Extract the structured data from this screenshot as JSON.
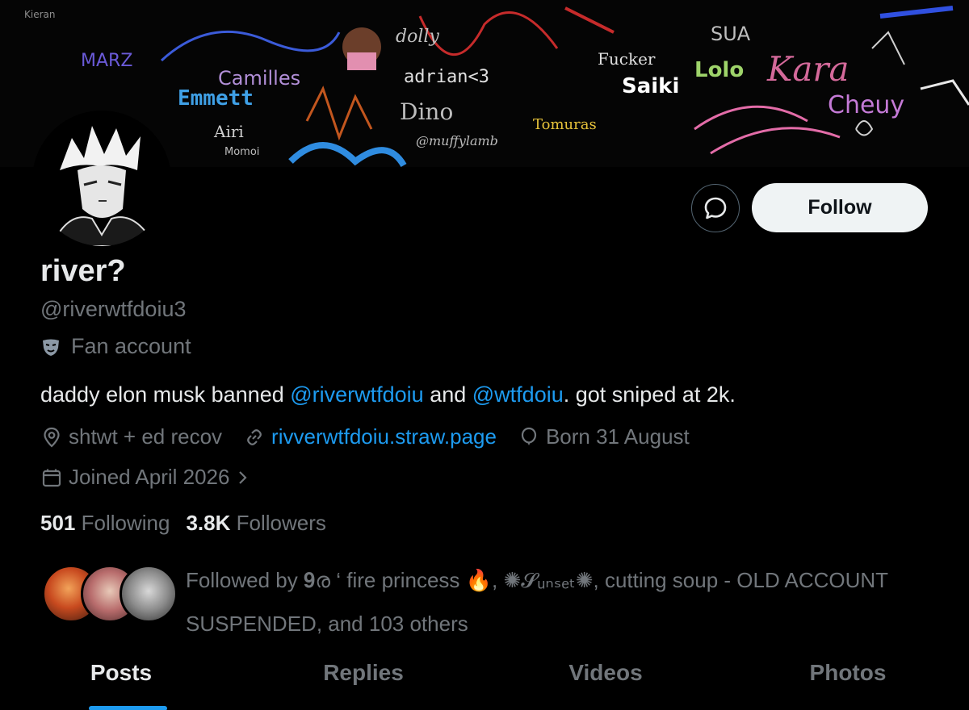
{
  "profile": {
    "display_name": "river?",
    "handle": "@riverwtfdoiu3",
    "category": "Fan account",
    "category_icon": "performing-arts-mask-icon"
  },
  "actions": {
    "follow_label": "Follow",
    "message_icon": "chat-bubble-icon"
  },
  "bio": {
    "text_1": "daddy elon musk banned ",
    "mention_1": "@riverwtfdoiu",
    "text_2": " and ",
    "mention_2": "@wtfdoiu",
    "text_3": ". got sniped at 2k."
  },
  "meta": {
    "location": "shtwt + ed recov",
    "website": "rivverwtfdoiu.straw.page",
    "birthday": "Born 31 August",
    "joined": "Joined April 2026"
  },
  "stats": {
    "following_count": "501",
    "following_label": "Following",
    "followers_count": "3.8K",
    "followers_label": "Followers"
  },
  "followed_by": {
    "prefix": "Followed by 𝟗ര ‘ fire princess  ",
    "emoji": "🔥",
    "sep1": ", ",
    "name2": "✺𝓢ᵤₙₛₑₜ✺",
    "rest": ", cutting soup - OLD ACCOUNT SUSPENDED, and 103 others"
  },
  "banner_words": [
    "Kieran",
    "Camilles",
    "Emmett",
    "adrian<3",
    "Dino",
    "@muffylamb",
    "Tomuras",
    "Saiki",
    "Cheuy",
    "Lolo",
    "MARZ",
    "Airi",
    "Momoi",
    "dolly",
    "SUA",
    "Kara",
    "Fucker"
  ],
  "tabs": [
    "Posts",
    "Replies",
    "Videos",
    "Photos"
  ],
  "colors": {
    "accent": "#1d9bf0",
    "text_primary": "#e7e9ea",
    "text_secondary": "#71767b",
    "background": "#000000"
  }
}
